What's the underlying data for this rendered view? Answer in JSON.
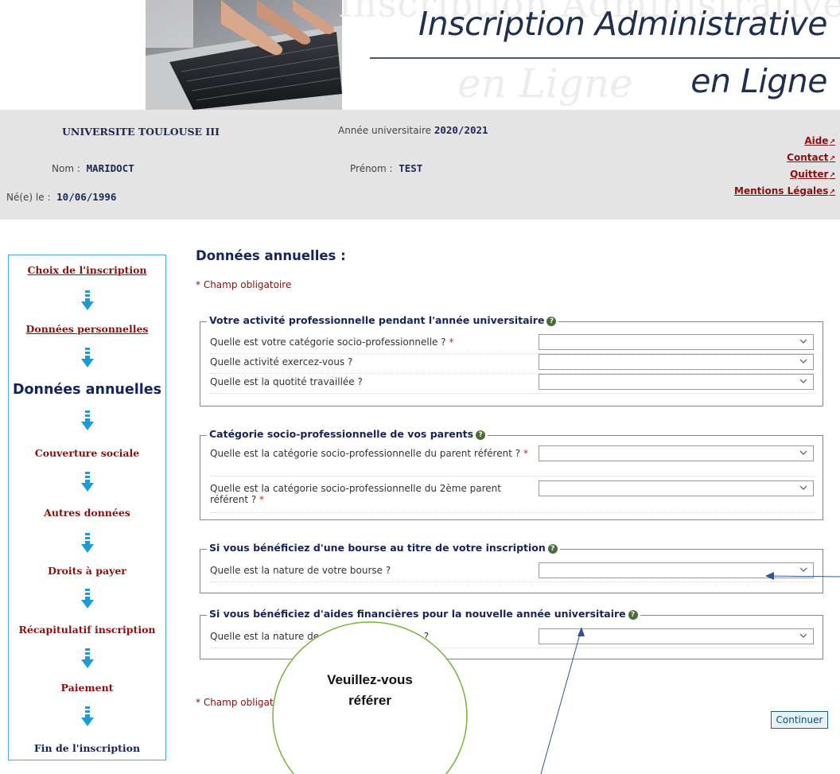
{
  "banner": {
    "title_line1": "Inscription Administrative",
    "title_line2": "en Ligne",
    "watermark_line1": "Inscription Administrative",
    "watermark_line2": "en Ligne"
  },
  "header": {
    "university": "UNIVERSITE TOULOUSE III",
    "year_label": "Année universitaire",
    "year_value": "2020/2021",
    "nom_label": "Nom :",
    "nom_value": "MARIDOCT",
    "prenom_label": "Prénom :",
    "prenom_value": "TEST",
    "birth_label": "Né(e) le :",
    "birth_value": "10/06/1996",
    "links": [
      "Aide",
      "Contact",
      "Quitter",
      "Mentions Légales"
    ]
  },
  "sidebar": {
    "steps": [
      {
        "label": "Choix de l'inscription",
        "state": "link"
      },
      {
        "label": "Données personnelles",
        "state": "link"
      },
      {
        "label": "Données annuelles",
        "state": "current"
      },
      {
        "label": "Couverture sociale",
        "state": "next"
      },
      {
        "label": "Autres données",
        "state": "next"
      },
      {
        "label": "Droits à payer",
        "state": "next"
      },
      {
        "label": "Récapitulatif inscription",
        "state": "next"
      },
      {
        "label": "Paiement",
        "state": "next"
      },
      {
        "label": "Fin de l'inscription",
        "state": "last"
      }
    ]
  },
  "main": {
    "title": "Données annuelles :",
    "required_note": "* Champ obligatoire",
    "sections": [
      {
        "legend": "Votre activité professionnelle pendant l'année universitaire",
        "questions": [
          {
            "label": "Quelle est votre catégorie socio-professionnelle ?",
            "required": "*",
            "value": ""
          },
          {
            "label": "Quelle activité exercez-vous ?",
            "required": "",
            "value": ""
          },
          {
            "label": "Quelle est la quotité travaillée ?",
            "required": "",
            "value": ""
          }
        ]
      },
      {
        "legend": "Catégorie socio-professionnelle de vos parents",
        "questions": [
          {
            "label": "Quelle est la catégorie socio-professionnelle du parent référent ?",
            "required": "*",
            "value": ""
          },
          {
            "label": "Quelle est la catégorie socio-professionnelle du 2ème parent référent ?",
            "required": "*",
            "value": ""
          }
        ]
      },
      {
        "legend": "Si vous bénéficiez d'une bourse au titre de votre inscription",
        "questions": [
          {
            "label": "Quelle est la nature de votre bourse ?",
            "required": "",
            "value": ""
          }
        ]
      },
      {
        "legend": "Si vous bénéficiez d'aides financières pour la nouvelle année universitaire",
        "questions": [
          {
            "label": "Quelle est la nature de votre aide financière ?",
            "required": "",
            "value": ""
          }
        ]
      }
    ],
    "continue_label": "Continuer"
  },
  "annotation": {
    "callout_line1": "Veuillez-vous",
    "callout_line2": "référer"
  },
  "colors": {
    "brand_navy": "#15245a",
    "link_red": "#8b0f0f",
    "info_bar_bg": "#e4e4e4",
    "sidebar_border": "#49a9d6",
    "arrow_blue": "#1e9ad6",
    "callout_green": "#78b43c",
    "pointer_blue": "#2f5597",
    "help_icon_green": "#4a6e37"
  }
}
